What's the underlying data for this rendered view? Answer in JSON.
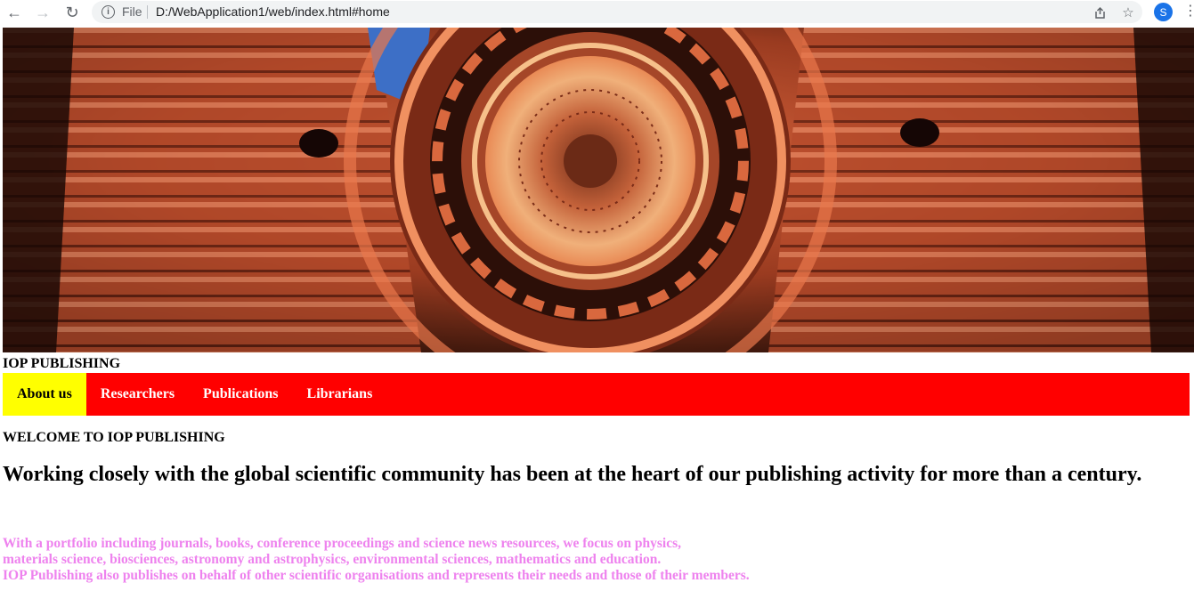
{
  "browser": {
    "scheme": "File",
    "url": "D:/WebApplication1/web/index.html#home",
    "profile_initial": "S"
  },
  "site": {
    "title": "IOP PUBLISHING",
    "nav": [
      {
        "label": "About us",
        "active": true
      },
      {
        "label": "Researchers",
        "active": false
      },
      {
        "label": "Publications",
        "active": false
      },
      {
        "label": "Librarians",
        "active": false
      }
    ],
    "welcome": "WELCOME TO IOP PUBLISHING",
    "lead": "Working closely with the global scientific community has been at the heart of our publishing activity for more than a century.",
    "portfolio": [
      "With a portfolio including journals, books, conference proceedings and science news resources, we focus on physics,",
      "materials science, biosciences, astronomy and astrophysics, environmental sciences, mathematics and education.",
      "IOP Publishing also publishes on behalf of other scientific organisations and represents their needs and those of their members."
    ]
  },
  "colors": {
    "nav_bg": "#ff0000",
    "nav_active_bg": "#ffff00",
    "portfolio_text": "#ee82ee"
  }
}
